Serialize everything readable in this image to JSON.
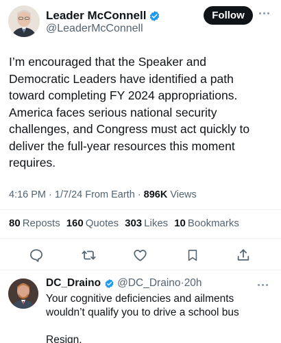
{
  "tweet": {
    "author_name": "Leader McConnell",
    "author_handle": "@LeaderMcConnell",
    "follow_label": "Follow",
    "text": "I’m encouraged that the Speaker and\nDemocratic Leaders have identified a path\ntoward completing FY 2024 appropriations.\nAmerica faces serious national security\nchallenges, and Congress must act quickly to\ndeliver the full-year resources this moment\nrequires.",
    "time": "4:16 PM",
    "date": "1/7/24",
    "source": "From Earth",
    "views_count": "896K",
    "views_label": "Views",
    "stats": {
      "reposts_count": "80",
      "reposts_label": "Reposts",
      "quotes_count": "160",
      "quotes_label": "Quotes",
      "likes_count": "303",
      "likes_label": "Likes",
      "bookmarks_count": "10",
      "bookmarks_label": "Bookmarks"
    }
  },
  "actions": [
    "reply-icon",
    "repost-icon",
    "like-icon",
    "bookmark-icon",
    "share-icon"
  ],
  "reply": {
    "author_name": "DC_Draino",
    "author_handle": "@DC_Draino",
    "age": "20h",
    "text": "Your cognitive deficiencies and ailments\nwouldn’t qualify you to drive a school bus\n\nResign."
  },
  "colors": {
    "text": "#0f1419",
    "secondary": "#536471",
    "verified": "#1d9bf0",
    "divider": "#eff3f4",
    "follow_bg": "#0f1419"
  }
}
